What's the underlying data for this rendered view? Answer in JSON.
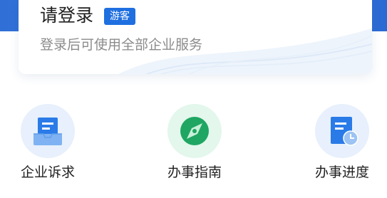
{
  "login": {
    "title": "请登录",
    "badge": "游客",
    "subtitle": "登录后可使用全部企业服务"
  },
  "services": [
    {
      "label": "企业诉求",
      "icon": "appeal-inbox-icon"
    },
    {
      "label": "办事指南",
      "icon": "compass-icon"
    },
    {
      "label": "办事进度",
      "icon": "progress-document-icon"
    }
  ],
  "colors": {
    "header_blue": "#2f6fd6",
    "badge_blue": "#1f6fe0",
    "icon_blue": "#2a7be8",
    "icon_green": "#1fa662"
  }
}
